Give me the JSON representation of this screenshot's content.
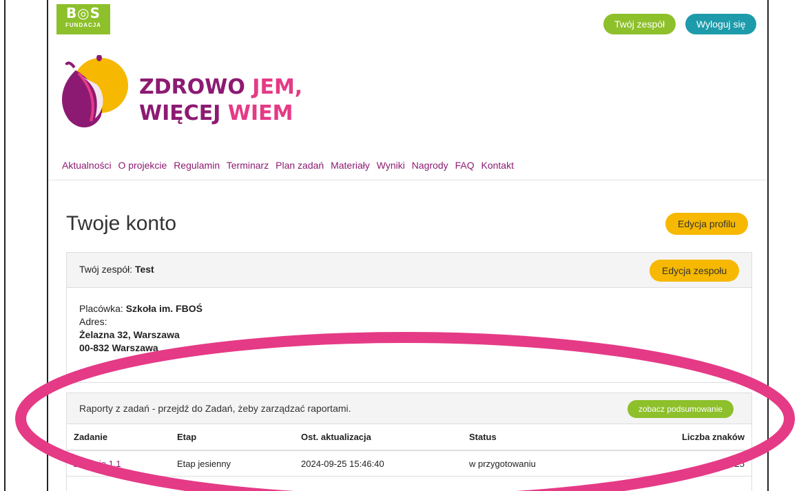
{
  "header": {
    "logo": {
      "text": "B◎S",
      "sub": "FUNDACJA"
    },
    "team_button": "Twój zespół",
    "logout_button": "Wyloguj się"
  },
  "brand": {
    "line1_a": "ZDROWO ",
    "line1_b": "JEM,",
    "line2_a": "WIĘCEJ ",
    "line2_b": "WIEM"
  },
  "nav": [
    "Aktualności",
    "O projekcie",
    "Regulamin",
    "Terminarz",
    "Plan zadań",
    "Materiały",
    "Wyniki",
    "Nagrody",
    "FAQ",
    "Kontakt"
  ],
  "account": {
    "title": "Twoje konto",
    "edit_profile": "Edycja profilu",
    "team_label": "Twój zespół:",
    "team_name": "Test",
    "edit_team": "Edycja zespołu",
    "facility_label": "Placówka:",
    "facility_name": "Szkoła im. FBOŚ",
    "address_label": "Adres:",
    "address_line1": "Żelazna 32, Warszawa",
    "address_line2": "00-832 Warszawa"
  },
  "reports": {
    "intro": "Raporty z zadań - przejdź do Zadań, żeby zarządzać raportami.",
    "summary_button": "zobacz podsumowanie",
    "columns": [
      "Zadanie",
      "Etap",
      "Ost. aktualizacja",
      "Status",
      "Liczba znaków"
    ],
    "rows": [
      {
        "task": "Zadanie 1.1",
        "stage": "Etap jesienny",
        "updated": "2024-09-25 15:46:40",
        "status": "w przygotowaniu",
        "chars": "25"
      }
    ]
  },
  "colors": {
    "green": "#8dc02b",
    "teal": "#1d9bab",
    "yellow": "#f6b800",
    "purple": "#8d1a72",
    "pink": "#e53a86"
  }
}
